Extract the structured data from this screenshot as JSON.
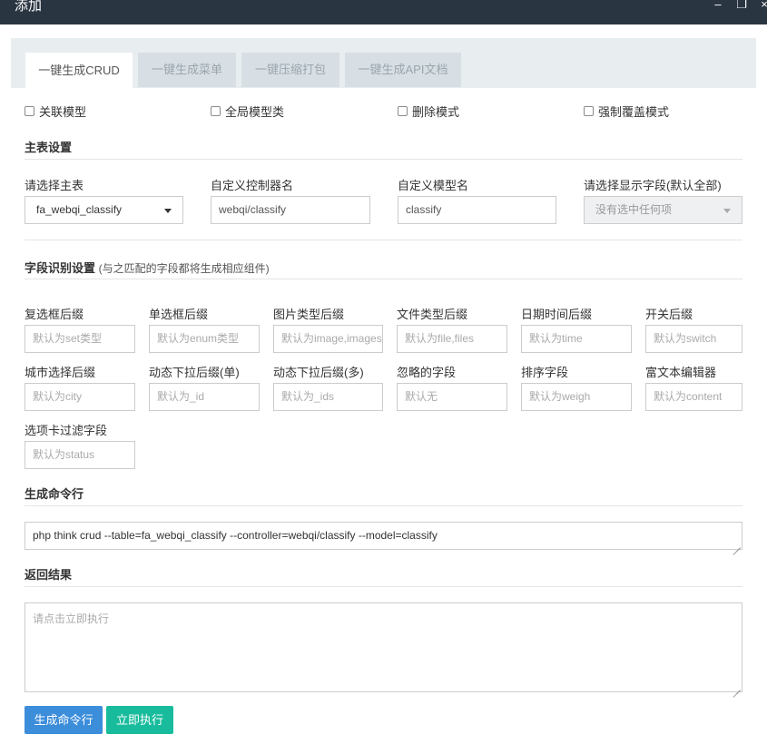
{
  "window": {
    "title": "添加",
    "minimize_glyph": "–",
    "maximize_glyph": "❐",
    "close_glyph": "×"
  },
  "tabs": [
    {
      "label": "一键生成CRUD",
      "active": true
    },
    {
      "label": "一键生成菜单",
      "active": false
    },
    {
      "label": "一键压缩打包",
      "active": false
    },
    {
      "label": "一键生成API文档",
      "active": false
    }
  ],
  "options": [
    {
      "label": "关联模型",
      "checked": false
    },
    {
      "label": "全局模型类",
      "checked": false
    },
    {
      "label": "删除模式",
      "checked": false
    },
    {
      "label": "强制覆盖模式",
      "checked": false
    }
  ],
  "main_settings": {
    "title": "主表设置",
    "fields": [
      {
        "label": "请选择主表",
        "type": "select",
        "value": "fa_webqi_classify"
      },
      {
        "label": "自定义控制器名",
        "type": "input",
        "value": "webqi/classify"
      },
      {
        "label": "自定义模型名",
        "type": "input",
        "value": "classify"
      },
      {
        "label": "请选择显示字段(默认全部)",
        "type": "select-disabled",
        "value": "没有选中任何项"
      }
    ]
  },
  "field_recognition": {
    "title": "字段识别设置",
    "note": "(与之匹配的字段都将生成相应组件)",
    "fields": [
      {
        "label": "复选框后缀",
        "placeholder": "默认为set类型"
      },
      {
        "label": "单选框后缀",
        "placeholder": "默认为enum类型"
      },
      {
        "label": "图片类型后缀",
        "placeholder": "默认为image,images"
      },
      {
        "label": "文件类型后缀",
        "placeholder": "默认为file,files"
      },
      {
        "label": "日期时间后缀",
        "placeholder": "默认为time"
      },
      {
        "label": "开关后缀",
        "placeholder": "默认为switch"
      },
      {
        "label": "城市选择后缀",
        "placeholder": "默认为city"
      },
      {
        "label": "动态下拉后缀(单)",
        "placeholder": "默认为_id"
      },
      {
        "label": "动态下拉后缀(多)",
        "placeholder": "默认为_ids"
      },
      {
        "label": "忽略的字段",
        "placeholder": "默认无"
      },
      {
        "label": "排序字段",
        "placeholder": "默认为weigh"
      },
      {
        "label": "富文本编辑器",
        "placeholder": "默认为content"
      },
      {
        "label": "选项卡过滤字段",
        "placeholder": "默认为status"
      }
    ]
  },
  "command": {
    "title": "生成命令行",
    "value": "php think crud --table=fa_webqi_classify --controller=webqi/classify --model=classify"
  },
  "result": {
    "title": "返回结果",
    "placeholder": "请点击立即执行"
  },
  "buttons": {
    "generate": "生成命令行",
    "execute": "立即执行"
  },
  "colors": {
    "titlebar": "#2a3542",
    "primary": "#3c8dda",
    "success": "#18bc9c"
  }
}
